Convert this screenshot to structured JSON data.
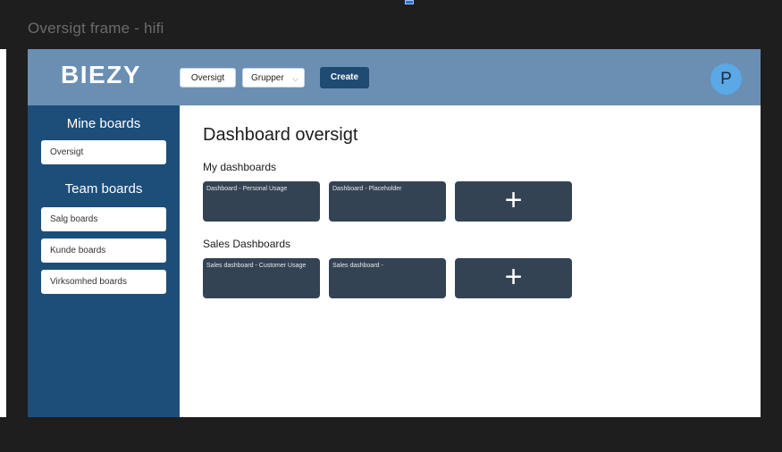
{
  "frame_title": "Oversigt frame - hifi",
  "topbar": {
    "logo": "BIEZY",
    "oversigt_label": "Oversigt",
    "grupper_label": "Grupper",
    "grupper_chevron": "⌵",
    "create_label": "Create",
    "avatar_initial": "P"
  },
  "sidebar": {
    "mine_heading": "Mine boards",
    "mine_items": [
      "Oversigt"
    ],
    "team_heading": "Team boards",
    "team_items": [
      "Salg boards",
      "Kunde boards",
      "Virksomhed boards"
    ]
  },
  "main": {
    "title": "Dashboard oversigt",
    "sections": [
      {
        "label": "My dashboards",
        "cards": [
          "Dashboard - Personal Usage",
          "Dashboard - Placeholder"
        ],
        "add_symbol": "+"
      },
      {
        "label": "Sales Dashboards",
        "cards": [
          "Sales dashboard - Customer Usage",
          "Sales dashboard -"
        ],
        "add_symbol": "+"
      }
    ]
  },
  "colors": {
    "topbar": "#6a8fb3",
    "sidebar": "#1d4e7a",
    "card": "#344354",
    "create_button": "#1f4a72",
    "avatar": "#5aa8e6"
  },
  "icons": {
    "add": "plus-icon",
    "dropdown": "chevron-down-icon"
  }
}
